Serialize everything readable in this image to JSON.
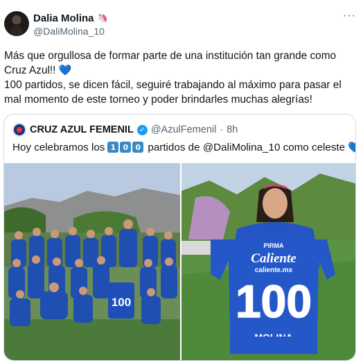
{
  "author": {
    "name": "Dalia Molina",
    "handle": "@DaliMolina_10",
    "name_emoji": "🦄"
  },
  "tweet": {
    "line1": "Más que orgullosa de formar parte de una institución tan grande como",
    "line2": "Cruz Azul!!",
    "line3": "100 partidos, se dicen fácil, seguiré trabajando al máximo para pasar el",
    "line4": "mal momento de este torneo y poder brindarles muchas alegrías!",
    "heart": "💙"
  },
  "quoted": {
    "name": "CRUZ AZUL FEMENIL",
    "verified": "✓",
    "handle": "@AzulFemenil",
    "separator": "·",
    "time": "8h",
    "text_before": "Hoy celebramos los",
    "keycaps": [
      "1",
      "0",
      "0"
    ],
    "text_after": "partidos de @DaliMolina_10 como celeste",
    "heart": "💙"
  },
  "jersey": {
    "sponsor_top": "PIRMA",
    "brand": "Caliente",
    "brand_sub": "caliente.mx",
    "number": "100",
    "player": "MOLINA"
  },
  "menu_icon": "more-options-icon",
  "colors": {
    "text": "#0f1419",
    "muted": "#536471",
    "verified": "#1d9bf0",
    "keycap": "#3b88c3",
    "cruz_azul_blue": "#1f3f9e"
  }
}
